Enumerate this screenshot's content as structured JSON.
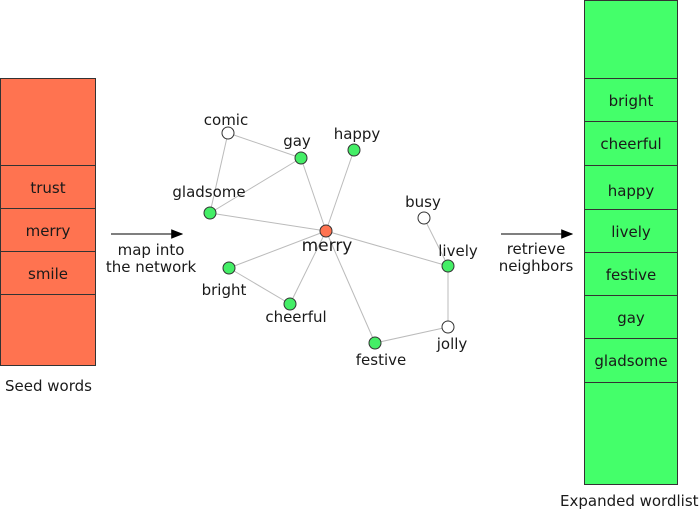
{
  "colors": {
    "seed": "#ff7350",
    "expanded": "#44ff6a",
    "node_seed": "#ff7350",
    "node_neighbor": "#44ee66",
    "node_other": "#ffffff",
    "edge": "#bbbbbb"
  },
  "seed": {
    "caption": "Seed words",
    "words": [
      "trust",
      "merry",
      "smile"
    ]
  },
  "arrow_left": {
    "line1": "map into",
    "line2": "the network"
  },
  "arrow_right": {
    "line1": "retrieve",
    "line2": "neighbors"
  },
  "expanded": {
    "caption": "Expanded wordlist",
    "words": [
      "bright",
      "cheerful",
      "happy",
      "lively",
      "festive",
      "gay",
      "gladsome"
    ]
  },
  "network": {
    "nodes": [
      {
        "id": "merry",
        "label": "merry",
        "type": "seed"
      },
      {
        "id": "comic",
        "label": "comic",
        "type": "other"
      },
      {
        "id": "gay",
        "label": "gay",
        "type": "neighbor"
      },
      {
        "id": "happy",
        "label": "happy",
        "type": "neighbor"
      },
      {
        "id": "gladsome",
        "label": "gladsome",
        "type": "neighbor"
      },
      {
        "id": "busy",
        "label": "busy",
        "type": "other"
      },
      {
        "id": "lively",
        "label": "lively",
        "type": "neighbor"
      },
      {
        "id": "bright",
        "label": "bright",
        "type": "neighbor"
      },
      {
        "id": "cheerful",
        "label": "cheerful",
        "type": "neighbor"
      },
      {
        "id": "festive",
        "label": "festive",
        "type": "neighbor"
      },
      {
        "id": "jolly",
        "label": "jolly",
        "type": "other"
      }
    ],
    "edges": [
      [
        "comic",
        "gay"
      ],
      [
        "comic",
        "gladsome"
      ],
      [
        "gay",
        "gladsome"
      ],
      [
        "gay",
        "merry"
      ],
      [
        "happy",
        "merry"
      ],
      [
        "gladsome",
        "merry"
      ],
      [
        "merry",
        "lively"
      ],
      [
        "merry",
        "bright"
      ],
      [
        "merry",
        "cheerful"
      ],
      [
        "merry",
        "festive"
      ],
      [
        "bright",
        "cheerful"
      ],
      [
        "busy",
        "lively"
      ],
      [
        "lively",
        "jolly"
      ],
      [
        "jolly",
        "festive"
      ]
    ]
  }
}
